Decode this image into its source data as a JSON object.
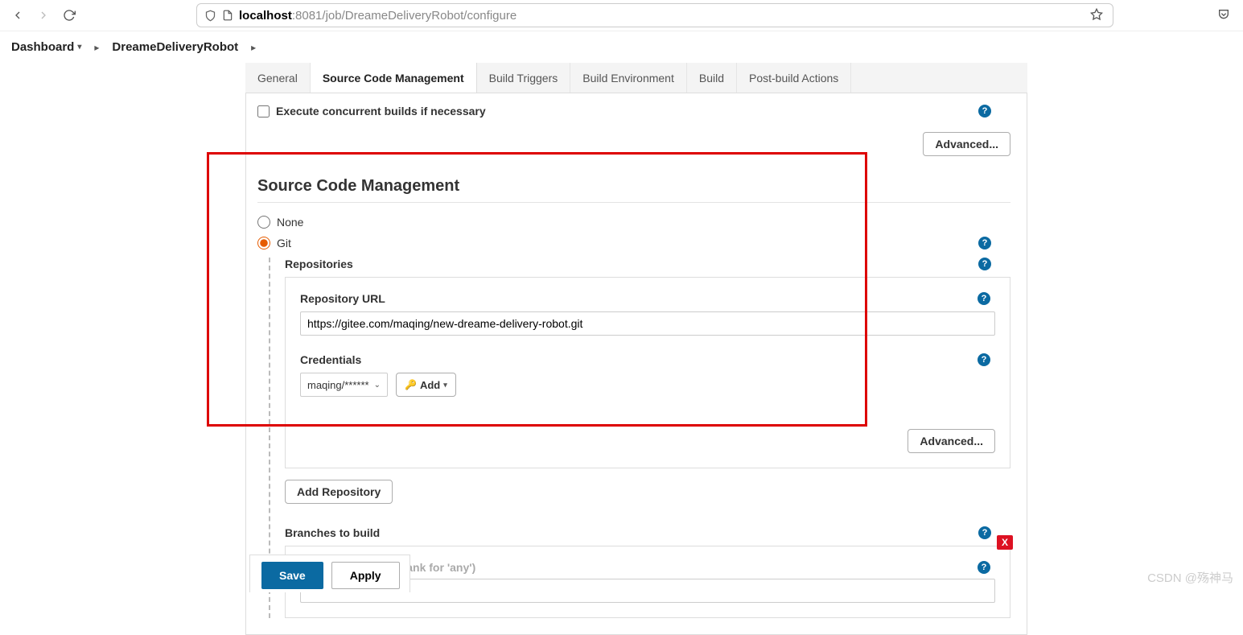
{
  "browser": {
    "url_host": "localhost",
    "url_port_path": ":8081/job/DreameDeliveryRobot/configure"
  },
  "breadcrumb": {
    "items": [
      "Dashboard",
      "DreameDeliveryRobot"
    ]
  },
  "tabs": {
    "general": "General",
    "scm": "Source Code Management",
    "triggers": "Build Triggers",
    "env": "Build Environment",
    "build": "Build",
    "post": "Post-build Actions"
  },
  "concurrent": {
    "label": "Execute concurrent builds if necessary"
  },
  "advanced": "Advanced...",
  "scm": {
    "title": "Source Code Management",
    "none": "None",
    "git": "Git",
    "repos_label": "Repositories",
    "repo_url_label": "Repository URL",
    "repo_url_value": "https://gitee.com/maqing/new-dreame-delivery-robot.git",
    "credentials_label": "Credentials",
    "credentials_value": "maqing/******",
    "add_label": "Add",
    "add_repo": "Add Repository",
    "branches_label": "Branches to build",
    "branch_spec_label": "Branch Specifier (blank for 'any')",
    "branch_spec_value": "",
    "delete": "X"
  },
  "actions": {
    "save": "Save",
    "apply": "Apply"
  },
  "watermark": "CSDN @殇神马"
}
